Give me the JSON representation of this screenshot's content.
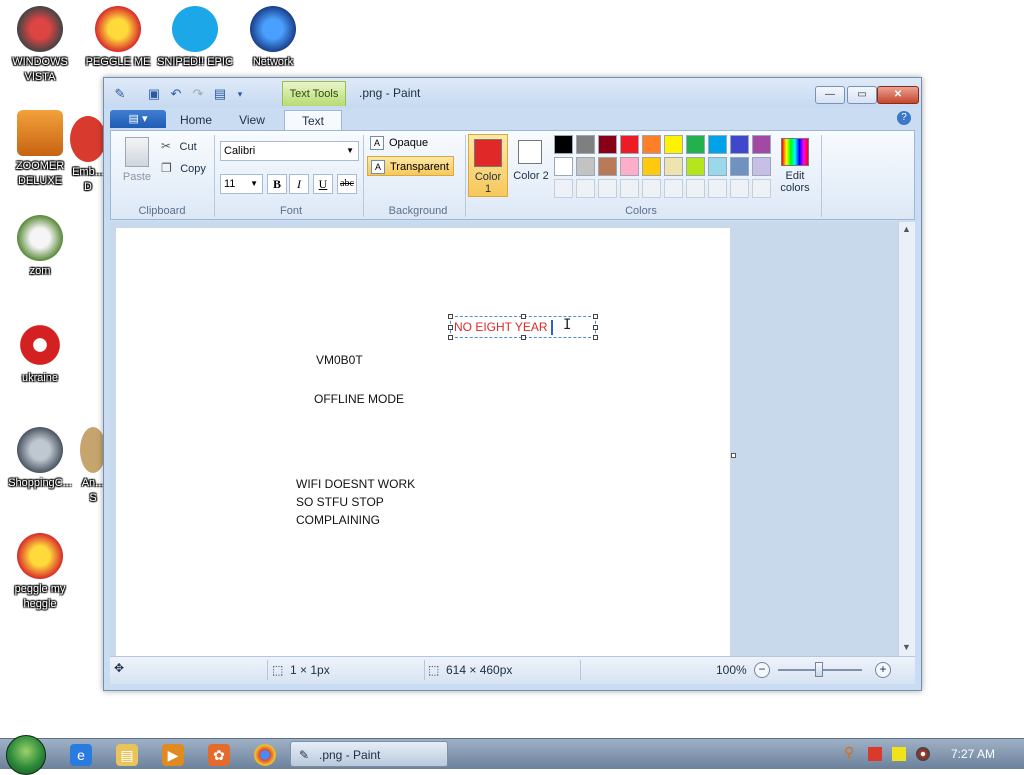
{
  "desktop": {
    "icons": [
      {
        "label": "WINDOWS VISTA"
      },
      {
        "label": "PEGGLE ME"
      },
      {
        "label": "SNIPED!! EPIC"
      },
      {
        "label": "Network"
      },
      {
        "label": "ZOOMER DELUXE"
      },
      {
        "label": "Emb... D"
      },
      {
        "label": "zom"
      },
      {
        "label": "ukraine"
      },
      {
        "label": "ShoppingC..."
      },
      {
        "label": "An... S"
      },
      {
        "label": "peggle my heggle"
      }
    ]
  },
  "window": {
    "title": ".png - Paint",
    "text_tools_label": "Text Tools"
  },
  "ribbon": {
    "tabs": {
      "home": "Home",
      "view": "View",
      "text": "Text"
    },
    "clipboard": {
      "paste": "Paste",
      "cut": "Cut",
      "copy": "Copy",
      "label": "Clipboard"
    },
    "font": {
      "family": "Calibri",
      "size": "11",
      "bold": "B",
      "italic": "I",
      "underline": "U",
      "strike": "abc",
      "label": "Font"
    },
    "background": {
      "opaque": "Opaque",
      "transparent": "Transparent",
      "label": "Background"
    },
    "colors": {
      "color1": "Color 1",
      "color2": "Color 2",
      "edit": "Edit colors",
      "label": "Colors",
      "color1_value": "#e02828",
      "color2_value": "#ffffff",
      "palette_row1": [
        "#000000",
        "#7f7f7f",
        "#880015",
        "#ed1c24",
        "#ff7f27",
        "#fff200",
        "#22b14c",
        "#00a2e8",
        "#3f48cc",
        "#a349a4"
      ],
      "palette_row2": [
        "#ffffff",
        "#c3c3c3",
        "#b97a57",
        "#ffaec9",
        "#ffc90e",
        "#efe4b0",
        "#b5e61d",
        "#99d9ea",
        "#7092be",
        "#c8bfe7"
      ]
    }
  },
  "canvas": {
    "textbox_text": "NO EIGHT YEAR",
    "line1": "VM0B0T",
    "line2": "OFFLINE MODE",
    "block": [
      "WIFI DOESNT WORK",
      "SO STFU STOP",
      "COMPLAINING"
    ]
  },
  "status": {
    "selection": "1 × 1px",
    "image_size": "614 × 460px",
    "zoom": "100%"
  },
  "taskbar": {
    "paint_task": ".png - Paint",
    "clock": "7:27 AM"
  }
}
